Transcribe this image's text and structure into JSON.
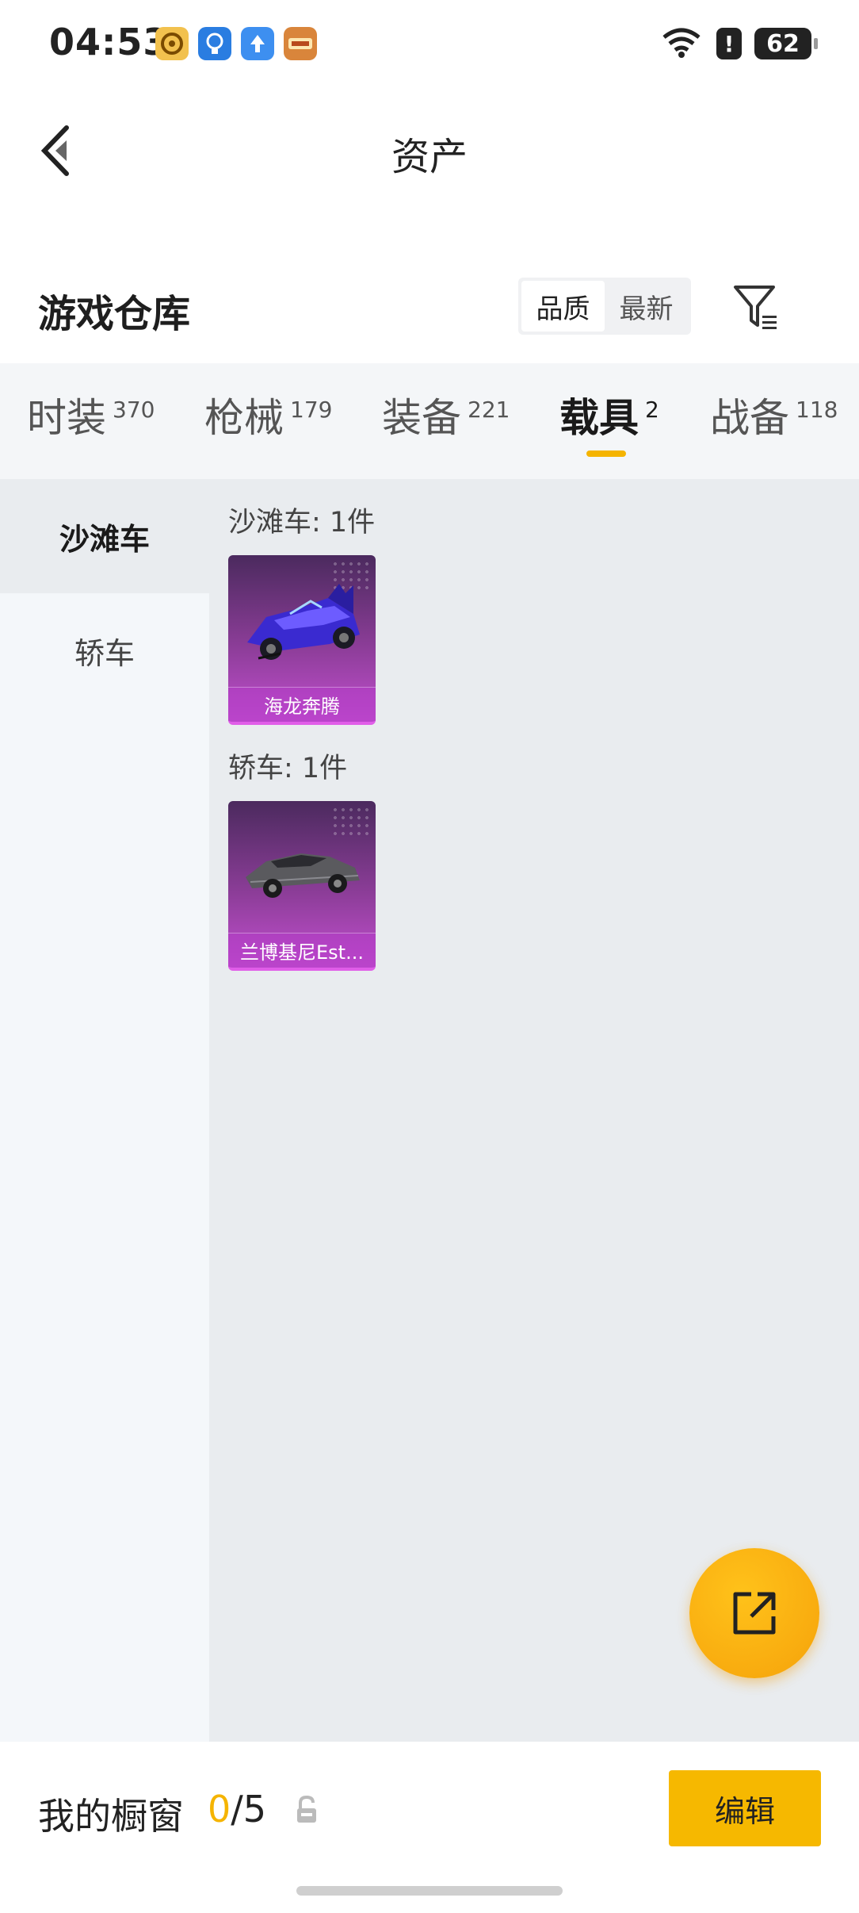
{
  "status_bar": {
    "time": "04:53",
    "battery": "62",
    "icons": [
      "app-icon-1",
      "lightbulb-icon",
      "upload-icon",
      "game-icon",
      "wifi-icon",
      "alert-icon",
      "battery-icon"
    ]
  },
  "header": {
    "title": "资产"
  },
  "section": {
    "title": "游戏仓库",
    "sort_options": [
      "品质",
      "最新"
    ],
    "sort_selected": "品质"
  },
  "tabs": [
    {
      "label": "时装",
      "count": "370"
    },
    {
      "label": "枪械",
      "count": "179"
    },
    {
      "label": "装备",
      "count": "221"
    },
    {
      "label": "载具",
      "count": "2",
      "active": true
    },
    {
      "label": "战备",
      "count": "118"
    }
  ],
  "sidebar": {
    "items": [
      {
        "label": "沙滩车",
        "active": true
      },
      {
        "label": "轿车"
      }
    ]
  },
  "groups": [
    {
      "label": "沙滩车: 1件",
      "items": [
        {
          "name": "海龙奔腾"
        }
      ]
    },
    {
      "label": "轿车: 1件",
      "items": [
        {
          "name": "兰博基尼Est..."
        }
      ]
    }
  ],
  "bottom_bar": {
    "showcase_label": "我的橱窗",
    "showcase_current": "0",
    "showcase_total": "/5",
    "edit_label": "编辑"
  },
  "colors": {
    "accent": "#f5b400",
    "card_gradient_top": "#4b2a5e",
    "card_gradient_bottom": "#c24fcf"
  }
}
